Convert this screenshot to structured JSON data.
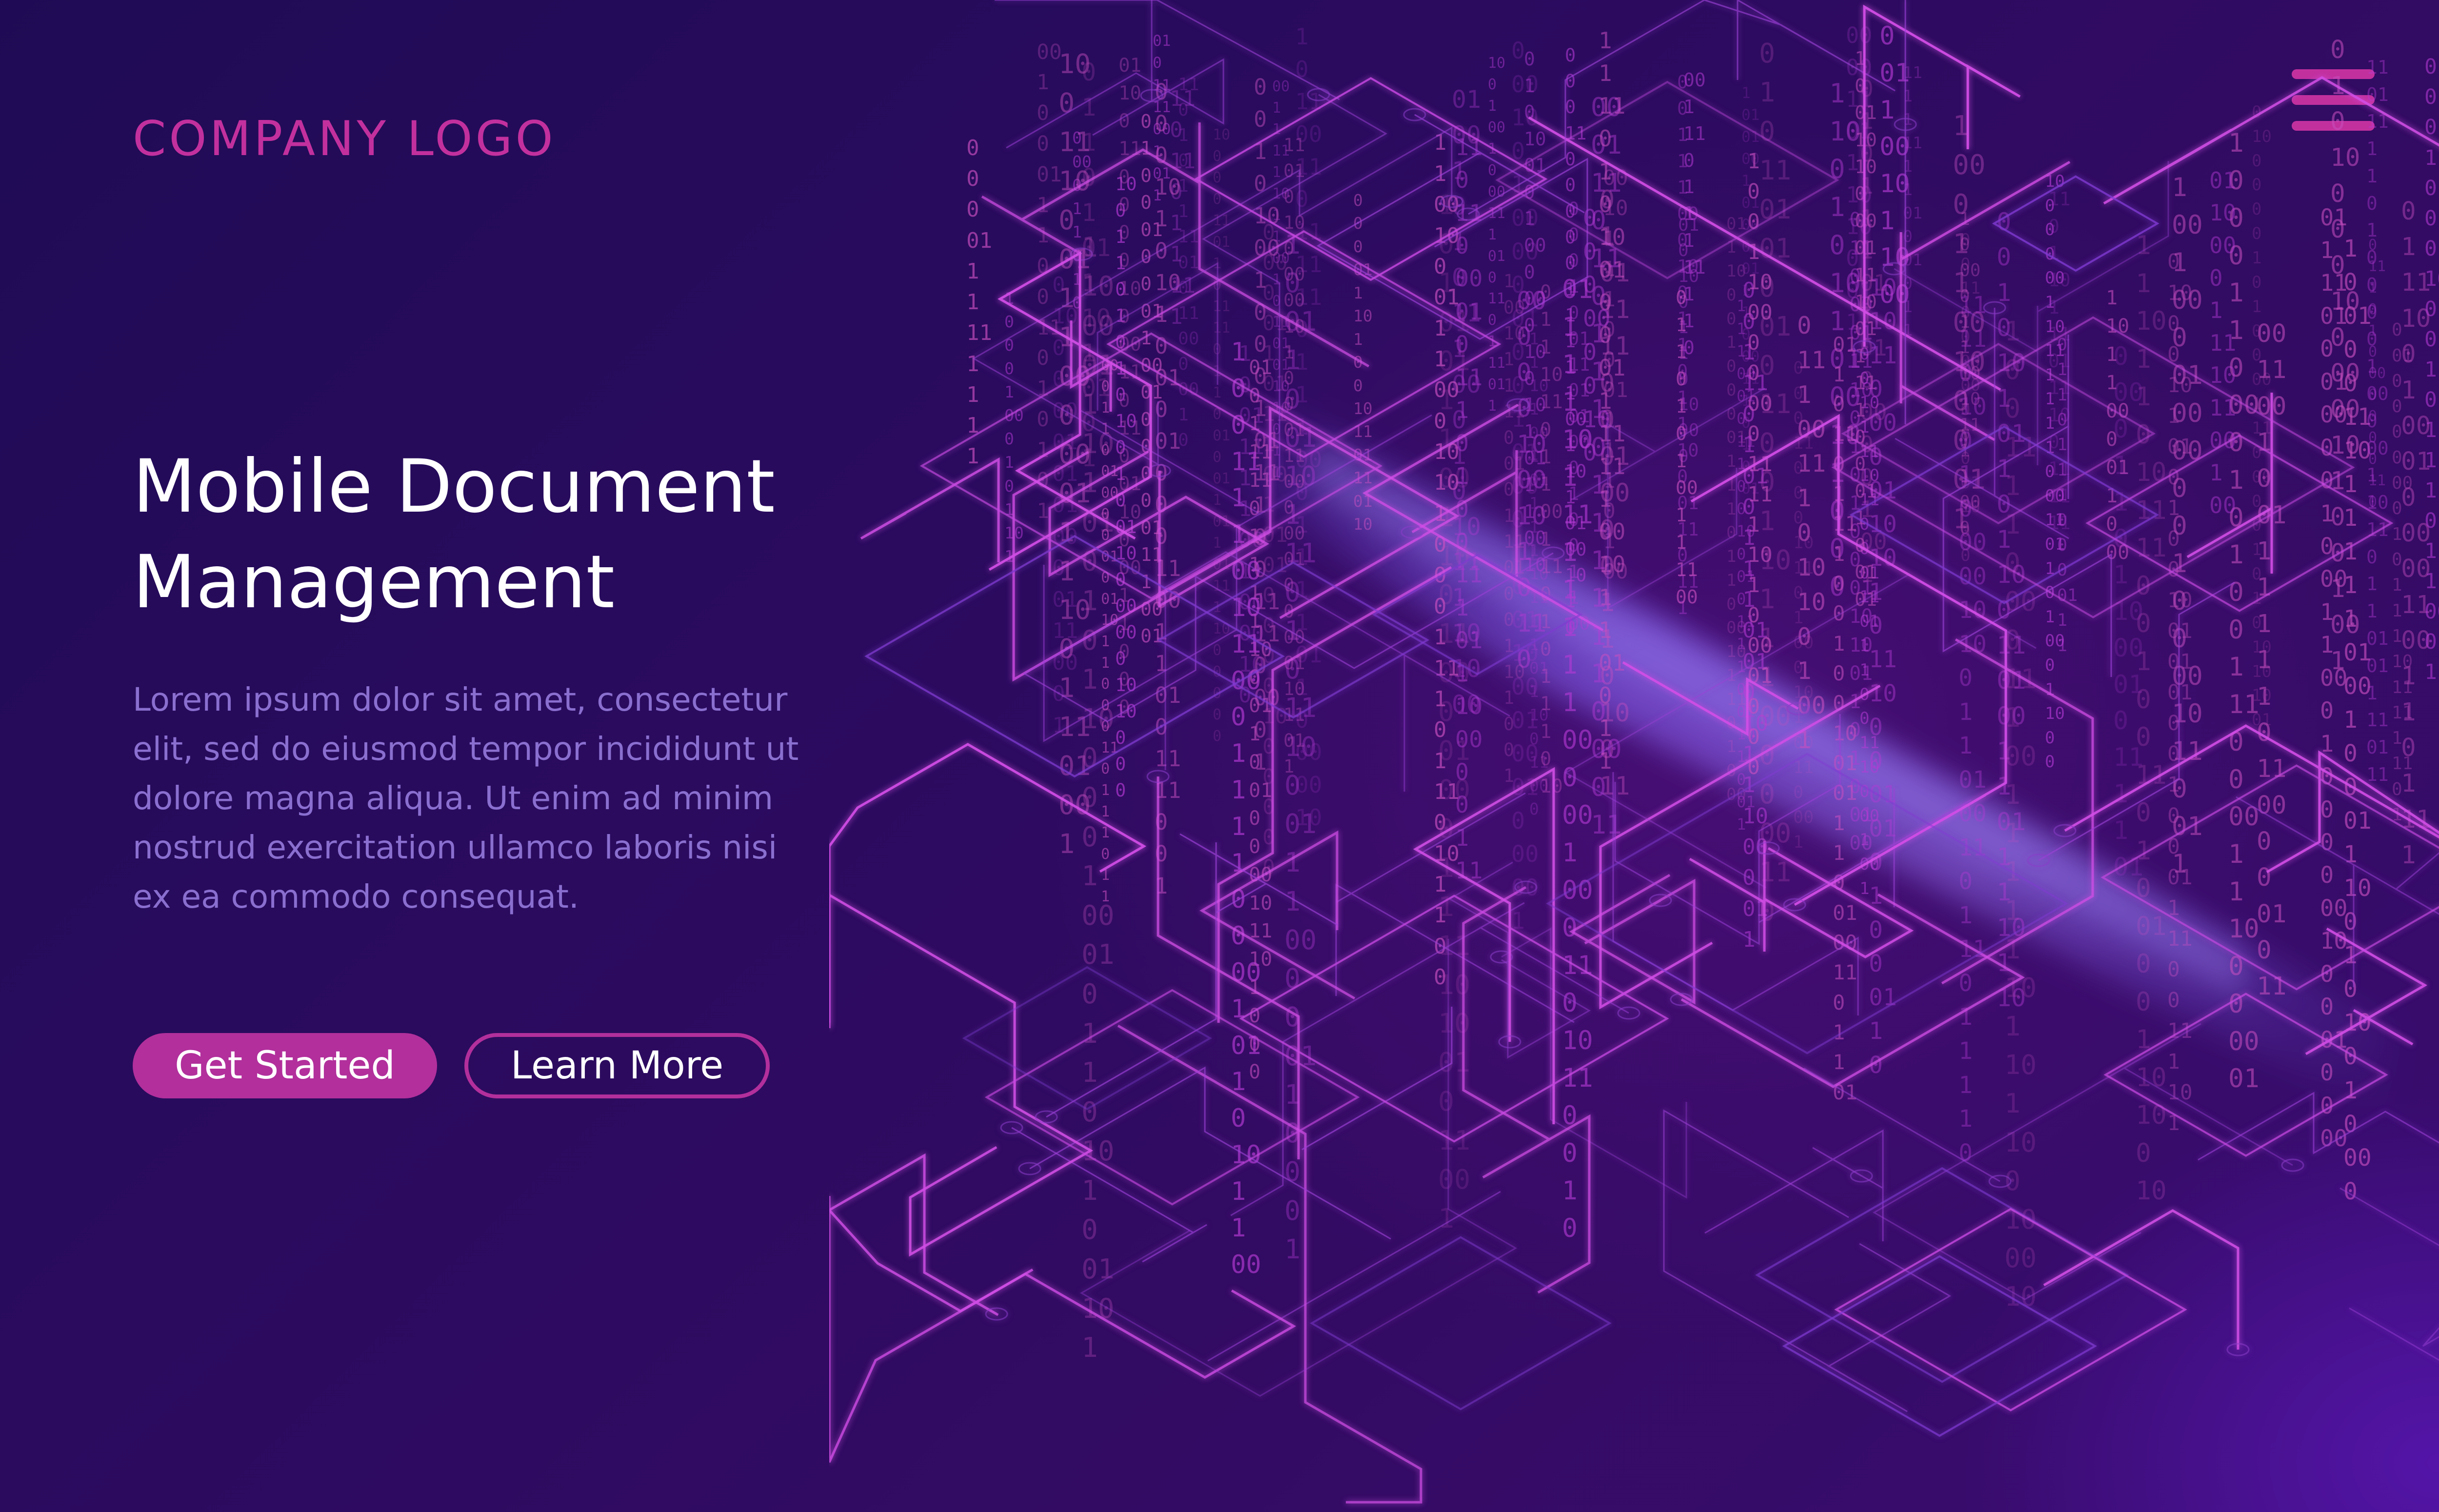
{
  "header": {
    "logo_text": "COMPANY LOGO",
    "menu_icon": "hamburger-menu-icon"
  },
  "hero": {
    "title_line1": "Mobile Document",
    "title_line2": "Management",
    "description": "Lorem ipsum dolor sit amet, consectetur elit, sed do eiusmod tempor incididunt ut dolore magna aliqua. Ut enim ad minim nostrud exercitation ullamco laboris nisi ex ea commodo consequat.",
    "primary_button_label": "Get Started",
    "secondary_button_label": "Learn More"
  },
  "colors": {
    "background_dark": "#1f0b55",
    "background_purple": "#3a0c70",
    "accent_magenta": "#c2309e",
    "button_fill": "#b22f9c",
    "body_text": "#8a6fd0",
    "title_text": "#ffffff"
  },
  "illustration": {
    "icon": "isometric-binary-circuit-illustration",
    "glyphs": [
      "0",
      "1"
    ]
  }
}
